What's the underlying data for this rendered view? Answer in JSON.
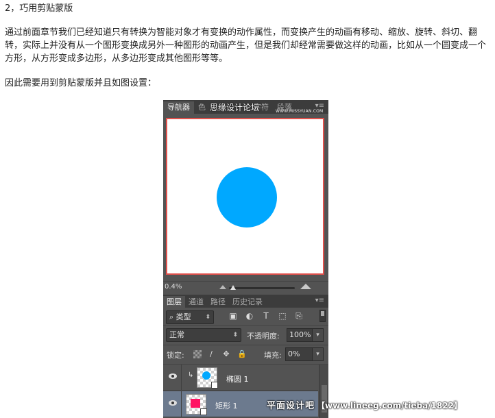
{
  "article": {
    "heading": "2，巧用剪贴蒙版",
    "intro": "通过前面章节我们已经知道只有转换为智能对象才有变换的动作属性，而变换产生的动画有移动、缩放、旋转、斜切、翻转，实际上并没有从一个图形变换成另外一种图形的动画产生，但是我们却经常需要做这样的动画，比如从一个圆变成一个方形，从方形变成多边形，从多边形变成其他图形等等。",
    "lead": "因此需要用到剪贴蒙版并且如图设置："
  },
  "navigator": {
    "tabs": [
      "导航器",
      "色",
      "字符",
      "段落"
    ],
    "watermark": "思缘设计论坛",
    "watermark_url": "WWW.MISSYUAN.COM",
    "zoom": "0.4%",
    "colors": {
      "circle": "#00a8ff",
      "frame": "#e0504b"
    }
  },
  "layers": {
    "tabs": [
      "图层",
      "通道",
      "路径",
      "历史记录"
    ],
    "filter_type": "类型",
    "blend_mode": "正常",
    "opacity_label": "不透明度:",
    "opacity": "100%",
    "lock_label": "锁定:",
    "fill_label": "填充:",
    "fill": "0%",
    "items": [
      {
        "name": "椭圆 1",
        "clipped": true,
        "selected": false
      },
      {
        "name": "矩形 1",
        "clipped": false,
        "selected": true
      }
    ]
  },
  "watermarks": {
    "site": "平面设计吧",
    "url": "【www.lineeg.com/tieba/1822】"
  }
}
